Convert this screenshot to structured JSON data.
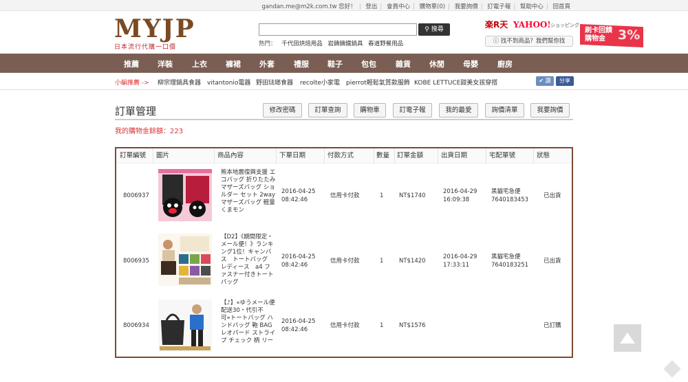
{
  "topbar": {
    "greeting": "gandan.me@m2k.com.tw 您好！",
    "links": [
      "登出",
      "會員中心",
      "購物車(0)",
      "我要詢價",
      "訂電子報",
      "幫助中心",
      "回首頁"
    ]
  },
  "header": {
    "logo_text": "MYJP",
    "logo_tagline": "日本流行代購一口價",
    "search": {
      "value": "",
      "button_label": "搜尋"
    },
    "hot_label": "熱門：",
    "hot_items": [
      "千代田烘焙用品",
      "岩鑄鑄鐵鍋具",
      "春道野餐用品"
    ],
    "rakuten": "楽R天",
    "yahoo": "YAHOO!",
    "yahoo_sub": "ショッピング",
    "help_button": "找不到商品？我們幫你找",
    "promo": {
      "line1": "刷卡回饋",
      "line2": "購物金",
      "pct": "3%"
    }
  },
  "nav": [
    "推薦",
    "洋裝",
    "上衣",
    "褲裙",
    "外套",
    "禮服",
    "鞋子",
    "包包",
    "雜貨",
    "休閒",
    "母嬰",
    "廚房"
  ],
  "subnav": {
    "label": "小編推薦 ->",
    "items": [
      "柳宗理鍋具食器",
      "vitantonio電器",
      "野田琺瑯食器",
      "recolte小家電",
      "pierrot輕鬆氣質款服飾",
      "KOBE LETTUCE甜美女孩穿搭"
    ],
    "share1": "讚",
    "share2": "分享"
  },
  "page": {
    "title": "訂單管理",
    "tabs": [
      "修改密碼",
      "訂單查詢",
      "購物車",
      "訂電子報",
      "我的最愛",
      "詢價清單",
      "我要詢價"
    ],
    "balance": "我的購物金餘額：223"
  },
  "table": {
    "headers": [
      "訂單編號",
      "圖片",
      "商品內容",
      "下單日期",
      "付款方式",
      "數量",
      "訂單金額",
      "出貨日期",
      "宅配單號",
      "狀態"
    ],
    "rows": [
      {
        "id": "8006937",
        "desc": "熊本地震復興支援 エコバッグ 折りたたみ マザーズバッグ ショルダー セット 2way マザーズバッグ 軽量 くまモン",
        "order_date": "2016-04-25",
        "order_time": "08:42:46",
        "payment": "信用卡付款",
        "qty": "1",
        "amount": "NT$1740",
        "ship_date": "2016-04-29",
        "ship_time": "16:09:38",
        "carrier": "黑貓宅急便",
        "tracking": "7640183453",
        "status": "已出貨"
      },
      {
        "id": "8006935",
        "desc": "【D2】《期間限定・メール便！》ランキング1位！キャンバス　トートバッグ　レディース　a4 ファスナー付きトートバッグ",
        "order_date": "2016-04-25",
        "order_time": "08:42:46",
        "payment": "信用卡付款",
        "qty": "1",
        "amount": "NT$1420",
        "ship_date": "2016-04-29",
        "ship_time": "17:33:11",
        "carrier": "黑貓宅急便",
        "tracking": "7640183251",
        "status": "已出貨"
      },
      {
        "id": "8006934",
        "desc": "【♪】«ゆうメール便配送30・代引不可»トートバッグ ハンドバッグ 鞄 BAG レオパード ストライプ チェック 柄 リー",
        "order_date": "2016-04-25",
        "order_time": "08:42:46",
        "payment": "信用卡付款",
        "qty": "1",
        "amount": "NT$1576",
        "ship_date": "",
        "ship_time": "",
        "carrier": "",
        "tracking": "",
        "status": "已訂購"
      }
    ]
  },
  "colors": {
    "nav_bg": "#7a5e54",
    "table_border": "#7a4a33",
    "accent_red": "#d33",
    "promo_bg": "#e8354a"
  }
}
